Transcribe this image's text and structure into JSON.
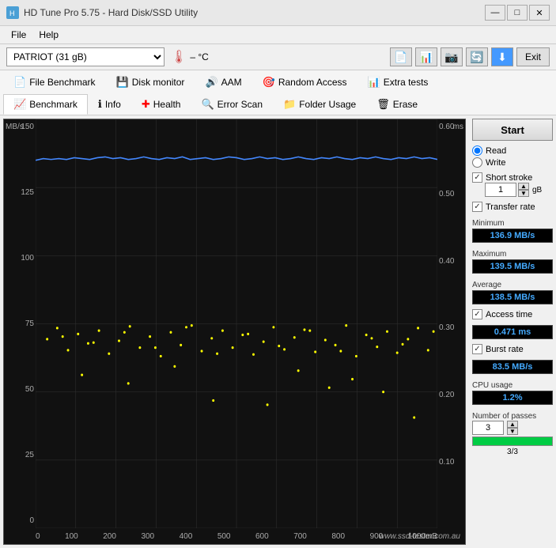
{
  "window": {
    "title": "HD Tune Pro 5.75 - Hard Disk/SSD Utility",
    "controls": [
      "—",
      "□",
      "✕"
    ]
  },
  "menu": {
    "items": [
      "File",
      "Help"
    ]
  },
  "toolbar": {
    "drive": "PATRIOT (31 gB)",
    "temperature": "– °C",
    "exit_label": "Exit"
  },
  "tabs": {
    "row1": [
      {
        "label": "File Benchmark",
        "icon": "📄"
      },
      {
        "label": "Disk monitor",
        "icon": "💾"
      },
      {
        "label": "AAM",
        "icon": "🔊"
      },
      {
        "label": "Random Access",
        "icon": "🎯"
      },
      {
        "label": "Extra tests",
        "icon": "📊"
      }
    ],
    "row2": [
      {
        "label": "Benchmark",
        "icon": "📈",
        "active": true
      },
      {
        "label": "Info",
        "icon": "ℹ"
      },
      {
        "label": "Health",
        "icon": "➕"
      },
      {
        "label": "Error Scan",
        "icon": "🔍"
      },
      {
        "label": "Folder Usage",
        "icon": "📁"
      },
      {
        "label": "Erase",
        "icon": "🗑"
      }
    ]
  },
  "chart": {
    "y_axis_left_label": "MB/s",
    "y_axis_right_label": "ms",
    "y_left_values": [
      "150",
      "125",
      "100",
      "75",
      "50",
      "25",
      "0"
    ],
    "y_right_values": [
      "0.60",
      "0.50",
      "0.40",
      "0.30",
      "0.20",
      "0.10",
      ""
    ],
    "x_values": [
      "0",
      "100",
      "200",
      "300",
      "400",
      "500",
      "600",
      "700",
      "800",
      "900",
      "1000mB"
    ]
  },
  "sidebar": {
    "start_label": "Start",
    "read_label": "Read",
    "write_label": "Write",
    "short_stroke_label": "Short stroke",
    "short_stroke_value": "1",
    "short_stroke_unit": "gB",
    "transfer_rate_label": "Transfer rate",
    "minimum_label": "Minimum",
    "minimum_value": "136.9 MB/s",
    "maximum_label": "Maximum",
    "maximum_value": "139.5 MB/s",
    "average_label": "Average",
    "average_value": "138.5 MB/s",
    "access_time_label": "Access time",
    "access_time_value": "0.471 ms",
    "burst_rate_label": "Burst rate",
    "burst_rate_value": "83.5 MB/s",
    "cpu_usage_label": "CPU usage",
    "cpu_usage_value": "1.2%",
    "passes_label": "Number of passes",
    "passes_value": "3",
    "passes_progress": "3/3"
  },
  "watermark": "www.ssd-tester.com.au"
}
